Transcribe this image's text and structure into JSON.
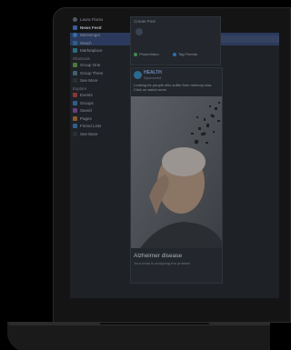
{
  "search": {
    "placeholder": "Search"
  },
  "left_nav": {
    "user": "Laura Flores",
    "items": [
      {
        "label": "News Feed",
        "active": true
      },
      {
        "label": "Messenger"
      },
      {
        "label": "Watch"
      },
      {
        "label": "Marketplace"
      }
    ],
    "shortcuts_title": "Shortcuts",
    "shortcuts": [
      "Group One",
      "Group Three",
      "See More"
    ],
    "explore_title": "Explore",
    "explore": [
      "Events",
      "Groups",
      "Saved",
      "Pages",
      "Friend Lists",
      "See More"
    ]
  },
  "composer": {
    "title": "Create Post",
    "btn_photo": "Photo/Video",
    "btn_tag": "Tag Friends"
  },
  "post": {
    "author": "HEALTH",
    "meta": "Sponsored",
    "text": "Looking for people who suffer from memory loss. Click on watch more",
    "caption": "Alzheimer disease",
    "subcaption": "Your brain is analyzing the problem"
  },
  "colors": {
    "brand": "#3b5998",
    "background": "#000000"
  }
}
